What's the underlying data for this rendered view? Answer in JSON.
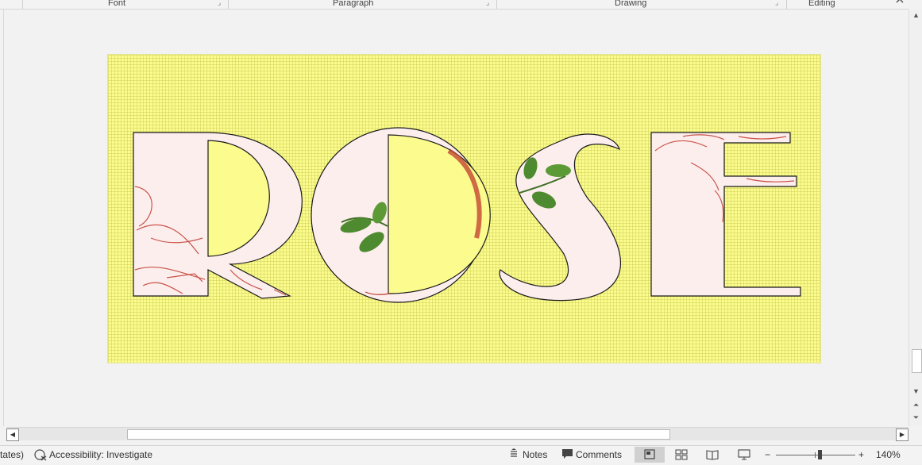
{
  "ribbon": {
    "groups": [
      {
        "label": "Font"
      },
      {
        "label": "Paragraph"
      },
      {
        "label": "Drawing"
      },
      {
        "label": "Editing"
      }
    ],
    "collapse_icon": "chevron-up-icon"
  },
  "document": {
    "word_art_text": "ROSE",
    "page_color": "#fbfb8e",
    "letter_fill": "#fdeeee",
    "letter_outline": "#1a1a1a",
    "floral_accent": "#c0392b",
    "leaf_color": "#4e8a2f"
  },
  "status_bar": {
    "predictions_fragment": "tates)",
    "accessibility_label": "Accessibility: Investigate",
    "notes_label": "Notes",
    "comments_label": "Comments",
    "zoom_minus": "−",
    "zoom_plus": "+",
    "zoom_level": "140%"
  }
}
